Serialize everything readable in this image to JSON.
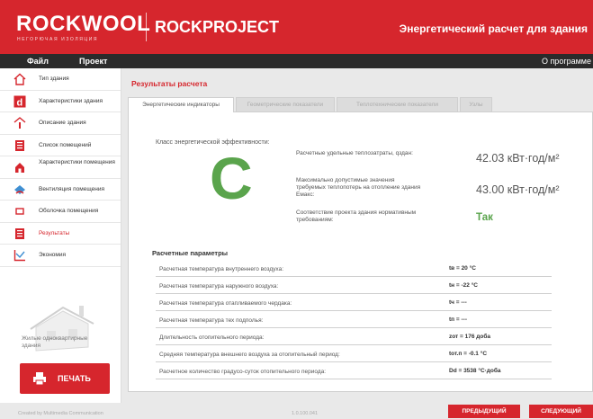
{
  "header": {
    "brand": "ROCKWOOL",
    "brand_sub": "НЕГОРЮЧАЯ ИЗОЛЯЦИЯ",
    "product": "ROCKPROJECT",
    "app_title": "Энергетический расчет для здания"
  },
  "menu": {
    "file": "Файл",
    "project": "Проект",
    "about": "О программе"
  },
  "sidebar": {
    "items": [
      {
        "label": "Тип здания",
        "icon": "house-icon"
      },
      {
        "label": "Характеристики здания",
        "icon": "letter-d-icon"
      },
      {
        "label": "Описание здания",
        "icon": "info-house-icon"
      },
      {
        "label": "Список помещений",
        "icon": "room-list-icon"
      },
      {
        "label": "Характеристики помещения",
        "icon": "room-characteristics-icon"
      },
      {
        "label": "Вентиляция помещения",
        "icon": "ventilation-icon"
      },
      {
        "label": "Оболочка помещения",
        "icon": "envelope-icon"
      },
      {
        "label": "Результаты",
        "icon": "results-icon"
      },
      {
        "label": "Экономия",
        "icon": "economy-chart-icon"
      }
    ],
    "house_caption": "Жилые одноквартирные здания",
    "print_label": "ПЕЧАТЬ"
  },
  "main": {
    "title": "Результаты расчета",
    "tabs": [
      "Энергетические индикаторы",
      "Геометрические показатели",
      "Теплотехнические показатели",
      "Узлы"
    ],
    "class_label": "Класс энергетической эффективности:",
    "grade": "C",
    "indicators": [
      {
        "label": "Расчетные удельные теплозатраты, qздан:",
        "value": "42.03 кВт·год/м²"
      },
      {
        "label": "Максимально допустимые значения требуемых теплопотерь на отопление здания Eмакс:",
        "value": "43.00 кВт·год/м²"
      },
      {
        "label": "Соответствие проекта здания нормативным требованиям:",
        "value": "Так"
      }
    ],
    "params_title": "Расчетные параметры",
    "params": [
      {
        "label": "Расчетная температура внутреннего воздуха:",
        "value": "tв = 20 °C"
      },
      {
        "label": "Расчетная температура наружного воздуха:",
        "value": "tн = -22 °C"
      },
      {
        "label": "Расчетная температура отапливаемого чердака:",
        "value": "tч = ---"
      },
      {
        "label": "Расчетная температура тех подполья:",
        "value": "tп = ---"
      },
      {
        "label": "Длительность отопительного периода:",
        "value": "zот = 176 доба"
      },
      {
        "label": "Средняя температура внешнего воздуха за отопительный период:",
        "value": "tот.п = -0.1 °C"
      },
      {
        "label": "Расчетное количество градусо-суток отопительного периода:",
        "value": "Dd = 3538 °С·доба"
      }
    ]
  },
  "footer": {
    "left": "Created by Multimedia Communication",
    "version": "1.0.100.041",
    "prev": "ПРЕДЫДУЩИЙ",
    "next": "СЛЕДУЮЩИЙ"
  },
  "colors": {
    "accent": "#d6262d",
    "grade": "#5aa44c",
    "menubar": "#2b2b2b"
  }
}
